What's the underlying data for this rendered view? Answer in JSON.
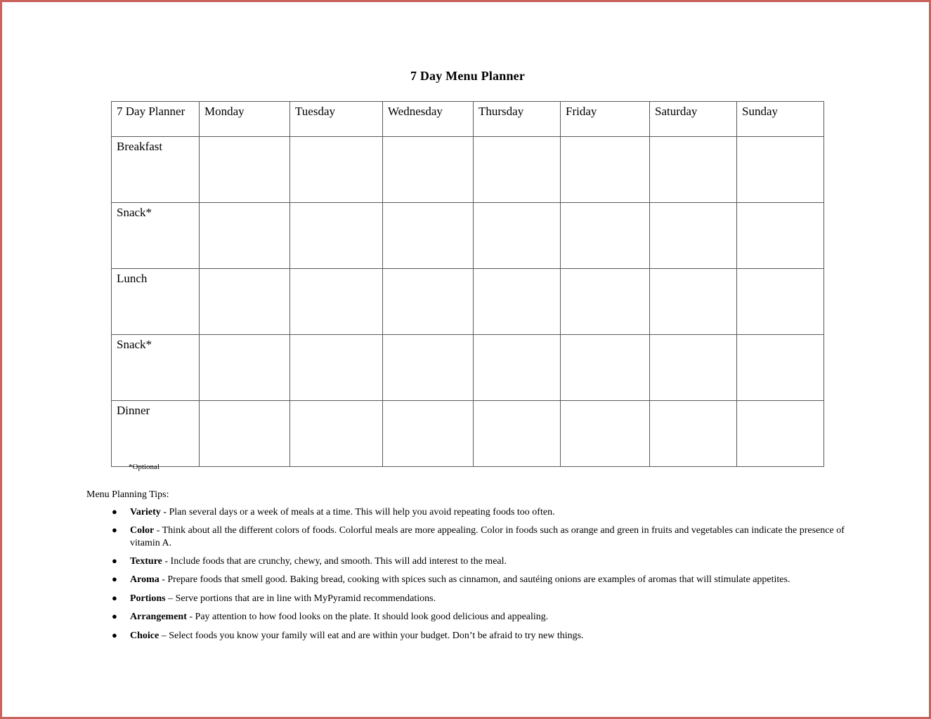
{
  "document": {
    "title": "7 Day Menu Planner",
    "optional_note": "*Optional"
  },
  "planner": {
    "corner_label": "7 Day Planner",
    "day_columns": [
      "Monday",
      "Tuesday",
      "Wednesday",
      "Thursday",
      "Friday",
      "Saturday",
      "Sunday"
    ],
    "meal_rows": [
      "Breakfast",
      "Snack*",
      "Lunch",
      "Snack*",
      "Dinner"
    ],
    "cells": [
      [
        "",
        "",
        "",
        "",
        "",
        "",
        ""
      ],
      [
        "",
        "",
        "",
        "",
        "",
        "",
        ""
      ],
      [
        "",
        "",
        "",
        "",
        "",
        "",
        ""
      ],
      [
        "",
        "",
        "",
        "",
        "",
        "",
        ""
      ],
      [
        "",
        "",
        "",
        "",
        "",
        "",
        ""
      ]
    ]
  },
  "tips": {
    "heading": "Menu Planning Tips:",
    "bullet_glyph": "●",
    "items": [
      {
        "term": "Variety",
        "text": " - Plan several days or a week of meals at a time. This will help you avoid repeating foods too often."
      },
      {
        "term": "Color",
        "text": " - Think about all the different colors of foods. Colorful meals are more appealing. Color in foods such as orange and green in fruits and vegetables can indicate the presence of vitamin A."
      },
      {
        "term": "Texture",
        "text": " - Include foods that are crunchy, chewy, and smooth. This will add interest to the meal."
      },
      {
        "term": "Aroma",
        "text": " - Prepare foods that smell good. Baking bread, cooking with spices such as cinnamon, and sautéing onions are examples of aromas that will stimulate appetites."
      },
      {
        "term": "Portions",
        "text": " – Serve portions that are in line with MyPyramid recommendations."
      },
      {
        "term": "Arrangement",
        "text": " - Pay attention to how food looks on the plate. It should look good delicious and appealing."
      },
      {
        "term": "Choice",
        "text": " – Select foods you know your family will eat and are within your budget.  Don’t be afraid to try new things."
      }
    ]
  },
  "colors": {
    "page_border": "#c9615c",
    "grid_line": "#5a5a5a",
    "text": "#000000",
    "background": "#ffffff"
  }
}
